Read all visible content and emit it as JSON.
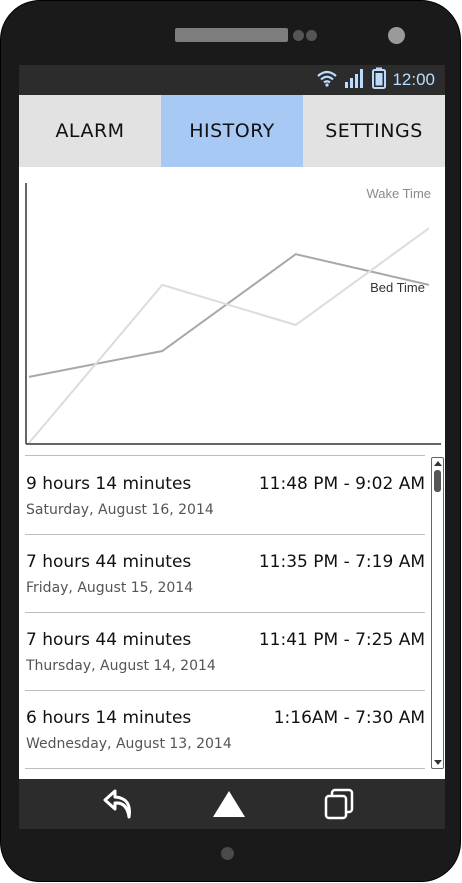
{
  "status": {
    "time": "12:00",
    "icons": [
      "wifi-icon",
      "signal-icon",
      "battery-icon"
    ]
  },
  "tabs": [
    {
      "label": "ALARM",
      "active": false
    },
    {
      "label": "HISTORY",
      "active": true
    },
    {
      "label": "SETTINGS",
      "active": false
    }
  ],
  "chart_data": {
    "type": "line",
    "series": [
      {
        "name": "Wake Time",
        "color": "#dcdcdc",
        "values": [
          0,
          0.67,
          0.5,
          0.91
        ]
      },
      {
        "name": "Bed Time",
        "color": "#a8a8a8",
        "values": [
          0.28,
          0.39,
          0.8,
          0.67
        ]
      }
    ],
    "axes": {
      "x_labels": false,
      "y_labels": false
    }
  },
  "entries": [
    {
      "duration": "9 hours 14 minutes",
      "range": "11:48 PM - 9:02 AM",
      "date": "Saturday, August 16, 2014"
    },
    {
      "duration": "7 hours 44 minutes",
      "range": "11:35 PM - 7:19 AM",
      "date": "Friday, August 15, 2014"
    },
    {
      "duration": "7 hours 44 minutes",
      "range": "11:41 PM - 7:25 AM",
      "date": "Thursday, August 14, 2014"
    },
    {
      "duration": "6 hours 14 minutes",
      "range": "1:16AM - 7:30 AM",
      "date": "Wednesday, August 13, 2014"
    }
  ],
  "nav": [
    "back-icon",
    "home-icon",
    "recent-apps-icon"
  ]
}
